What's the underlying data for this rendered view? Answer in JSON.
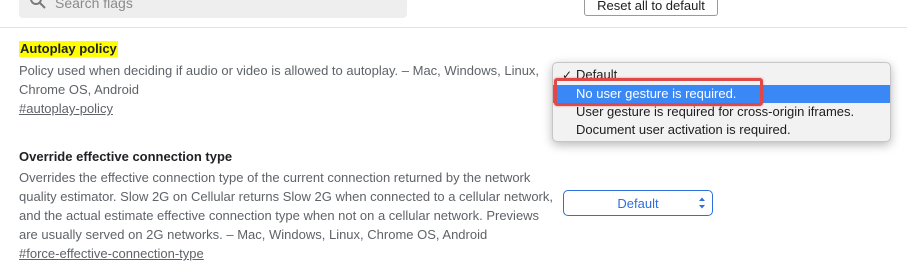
{
  "search": {
    "placeholder": "Search flags"
  },
  "toolbar": {
    "reset_label": "Reset all to default"
  },
  "flags": [
    {
      "title": "Autoplay policy",
      "description_lines": [
        "Policy used when deciding if audio or video is allowed to autoplay. – Mac, Windows, Linux,",
        "Chrome OS, Android"
      ],
      "link": "#autoplay-policy",
      "select_value": "Default"
    },
    {
      "title": "Override effective connection type",
      "description_lines": [
        "Overrides the effective connection type of the current connection returned by the network",
        "quality estimator. Slow 2G on Cellular returns Slow 2G when connected to a cellular network,",
        "and the actual estimate effective connection type when not on a cellular network. Previews",
        "are usually served on 2G networks. – Mac, Windows, Linux, Chrome OS, Android"
      ],
      "link": "#force-effective-connection-type",
      "select_value": "Default"
    }
  ],
  "dropdown": {
    "options": [
      "Default",
      "No user gesture is required.",
      "User gesture is required for cross-origin iframes.",
      "Document user activation is required."
    ],
    "checked_index": 0,
    "highlighted_index": 1,
    "check_glyph": "✓",
    "highlight_color": "#3a88f5",
    "annotation_color": "#e04848"
  },
  "colors": {
    "accent": "#2d6fdc",
    "title_highlight": "#ffff00"
  }
}
